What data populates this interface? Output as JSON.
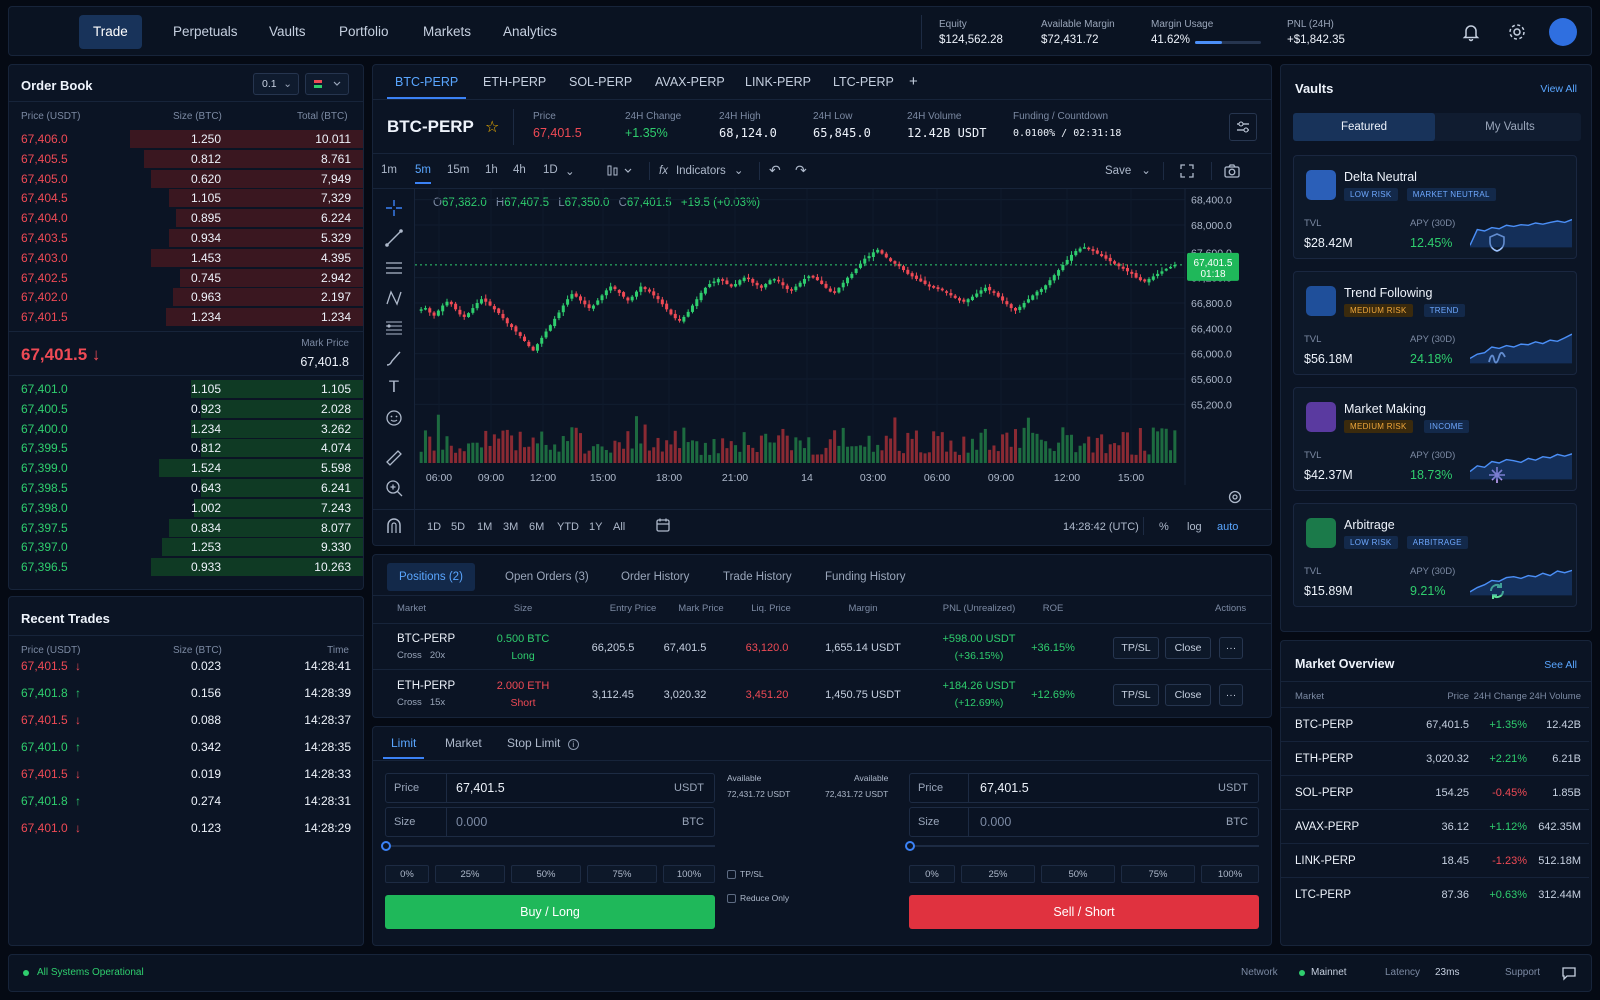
{
  "nav": {
    "tabs": [
      "Trade",
      "Perpetuals",
      "Vaults",
      "Portfolio",
      "Markets",
      "Analytics"
    ],
    "active": "Trade"
  },
  "account": {
    "equity": {
      "label": "Equity",
      "value": "$124,562.28"
    },
    "available": {
      "label": "Available Margin",
      "value": "$72,431.72"
    },
    "margin_usage": {
      "label": "Margin Usage",
      "value": "41.62%",
      "fraction": 0.4162
    },
    "pnl": {
      "label": "PNL (24H)",
      "value": "+$1,842.35"
    }
  },
  "orderbook": {
    "title": "Order Book",
    "grouping": "0.1",
    "col_price": "Price (USDT)",
    "col_size": "Size (BTC)",
    "col_total": "Total (BTC)",
    "asks": [
      [
        "67,406.0",
        "1.250",
        "10.011"
      ],
      [
        "67,405.5",
        "0.812",
        "8.761"
      ],
      [
        "67,405.0",
        "0.620",
        "7,949"
      ],
      [
        "67,404.5",
        "1.105",
        "7,329"
      ],
      [
        "67,404.0",
        "0.895",
        "6.224"
      ],
      [
        "67,403.5",
        "0.934",
        "5.329"
      ],
      [
        "67,403.0",
        "1.453",
        "4.395"
      ],
      [
        "67,402.5",
        "0.745",
        "2.942"
      ],
      [
        "67,402.0",
        "0.963",
        "2.197"
      ],
      [
        "67,401.5",
        "1.234",
        "1.234"
      ]
    ],
    "ask_depth": [
      0.66,
      0.62,
      0.6,
      0.55,
      0.53,
      0.55,
      0.6,
      0.52,
      0.54,
      0.56
    ],
    "last_price": "67,401.5",
    "mark_label": "Mark Price",
    "mark_price": "67,401.8",
    "bids": [
      [
        "67,401.0",
        "1.105",
        "1.105"
      ],
      [
        "67,400.5",
        "0.923",
        "2.028"
      ],
      [
        "67,400.0",
        "1.234",
        "3.262"
      ],
      [
        "67,399.5",
        "0.812",
        "4.074"
      ],
      [
        "67,399.0",
        "1.524",
        "5.598"
      ],
      [
        "67,398.5",
        "0.643",
        "6.241"
      ],
      [
        "67,398.0",
        "1.002",
        "7.243"
      ],
      [
        "67,397.5",
        "0.834",
        "8.077"
      ],
      [
        "67,397.0",
        "1.253",
        "9.330"
      ],
      [
        "67,396.5",
        "0.933",
        "10.263"
      ]
    ],
    "bid_depth": [
      0.49,
      0.46,
      0.49,
      0.46,
      0.58,
      0.46,
      0.48,
      0.55,
      0.57,
      0.6
    ]
  },
  "recent_trades": {
    "title": "Recent Trades",
    "col_price": "Price (USDT)",
    "col_size": "Size (BTC)",
    "col_time": "Time",
    "rows": [
      [
        "67,401.5",
        "0.023",
        "14:28:41",
        "down"
      ],
      [
        "67,401.8",
        "0.156",
        "14:28:39",
        "up"
      ],
      [
        "67,401.5",
        "0.088",
        "14:28:37",
        "down"
      ],
      [
        "67,401.0",
        "0.342",
        "14:28:35",
        "up"
      ],
      [
        "67,401.5",
        "0.019",
        "14:28:33",
        "down"
      ],
      [
        "67,401.8",
        "0.274",
        "14:28:31",
        "up"
      ],
      [
        "67,401.0",
        "0.123",
        "14:28:29",
        "down"
      ]
    ]
  },
  "markets": {
    "tabs": [
      "BTC-PERP",
      "ETH-PERP",
      "SOL-PERP",
      "AVAX-PERP",
      "LINK-PERP",
      "LTC-PERP"
    ],
    "add": "+"
  },
  "ticker": {
    "symbol": "BTC-PERP",
    "price": {
      "label": "Price",
      "value": "67,401.5"
    },
    "change": {
      "label": "24H Change",
      "value": "+1.35%"
    },
    "high": {
      "label": "24H High",
      "value": "68,124.0"
    },
    "low": {
      "label": "24H Low",
      "value": "65,845.0"
    },
    "volume": {
      "label": "24H Volume",
      "value": "12.42B USDT"
    },
    "funding": {
      "label": "Funding / Countdown",
      "value": "0.0100% / 02:31:18"
    }
  },
  "chart_toolbar": {
    "timeframes": [
      "1m",
      "5m",
      "15m",
      "1h",
      "4h",
      "1D"
    ],
    "active": "5m",
    "indicators": "Indicators",
    "save": "Save"
  },
  "ohlc": {
    "o": "67,382.0",
    "h": "67,407.5",
    "l": "67,350.0",
    "c": "67,401.5",
    "chg": "+19.5 (+0.03%)"
  },
  "chart_data": {
    "type": "candlestick",
    "y_ticks": [
      "68,400.0",
      "68,000.0",
      "67,600.0",
      "67,200.0",
      "66,800.0",
      "66,400.0",
      "66,000.0",
      "65,600.0",
      "65,200.0"
    ],
    "x_ticks": [
      "06:00",
      "09:00",
      "12:00",
      "15:00",
      "18:00",
      "21:00",
      "14",
      "03:00",
      "06:00",
      "09:00",
      "12:00",
      "15:00"
    ],
    "ylim": [
      65000,
      68600
    ],
    "close_series": [
      66700,
      66720,
      66650,
      66600,
      66680,
      66760,
      66820,
      66780,
      66700,
      66620,
      66580,
      66640,
      66720,
      66800,
      66860,
      66820,
      66760,
      66700,
      66640,
      66560,
      66480,
      66420,
      66350,
      66280,
      66200,
      66120,
      66050,
      66150,
      66250,
      66350,
      66450,
      66550,
      66650,
      66760,
      66860,
      66940,
      66900,
      66840,
      66780,
      66720,
      66760,
      66840,
      66920,
      67000,
      67060,
      67020,
      66960,
      66900,
      66840,
      66900,
      66980,
      67060,
      67020,
      66980,
      66920,
      66860,
      66780,
      66700,
      66620,
      66560,
      66520,
      66580,
      66660,
      66760,
      66860,
      66960,
      67040,
      67100,
      67140,
      67180,
      67150,
      67100,
      67060,
      67100,
      67160,
      67200,
      67180,
      67120,
      67080,
      67040,
      67100,
      67160,
      67180,
      67140,
      67080,
      67020,
      67000,
      67060,
      67120,
      67180,
      67220,
      67200,
      67160,
      67100,
      67040,
      66980,
      66960,
      67040,
      67120,
      67200,
      67260,
      67340,
      67420,
      67500,
      67540,
      67600,
      67640,
      67580,
      67520,
      67460,
      67420,
      67380,
      67320,
      67260,
      67220,
      67180,
      67140,
      67100,
      67060,
      67040,
      67020,
      67000,
      66960,
      66920,
      66880,
      66840,
      66820,
      66860,
      66900,
      66950,
      67000,
      67040,
      67000,
      66960,
      66900,
      66840,
      66780,
      66720,
      66680,
      66740,
      66800,
      66860,
      66920,
      66980,
      67020,
      67080,
      67160,
      67240,
      67320,
      67400,
      67480,
      67560,
      67620,
      67660,
      67680,
      67660,
      67620,
      67580,
      67540,
      67500,
      67460,
      67420,
      67380,
      67340,
      67300,
      67260,
      67200,
      67160,
      67140,
      67180,
      67220,
      67260,
      67300,
      67340,
      67370,
      67401.5
    ],
    "last_label": "67,401.5",
    "countdown": "01:18"
  },
  "chart_bottom": {
    "ranges": [
      "1D",
      "5D",
      "1M",
      "3M",
      "6M",
      "YTD",
      "1Y",
      "All"
    ],
    "time": "14:28:42 (UTC)",
    "pct": "%",
    "log": "log",
    "auto": "auto"
  },
  "positions": {
    "tabs": [
      "Positions (2)",
      "Open Orders (3)",
      "Order History",
      "Trade History",
      "Funding History"
    ],
    "headers": [
      "Market",
      "Size",
      "Entry Price",
      "Mark Price",
      "Liq. Price",
      "Margin",
      "PNL (Unrealized)",
      "ROE",
      "Actions"
    ],
    "rows": [
      {
        "market": "BTC-PERP",
        "mode": "Cross",
        "lev": "20x",
        "size": "0.500 BTC",
        "side": "Long",
        "entry": "66,205.5",
        "mark": "67,401.5",
        "liq": "63,120.0",
        "margin": "1,655.14 USDT",
        "pnl": "+598.00 USDT",
        "pnl_pct": "(+36.15%)",
        "roe": "+36.15%",
        "tpsl": "TP/SL",
        "close": "Close",
        "more": "···"
      },
      {
        "market": "ETH-PERP",
        "mode": "Cross",
        "lev": "15x",
        "size": "2.000 ETH",
        "side": "Short",
        "entry": "3,112.45",
        "mark": "3,020.32",
        "liq": "3,451.20",
        "margin": "1,450.75 USDT",
        "pnl": "+184.26 USDT",
        "pnl_pct": "(+12.69%)",
        "roe": "+12.69%",
        "tpsl": "TP/SL",
        "close": "Close",
        "more": "···"
      }
    ]
  },
  "order_form": {
    "tabs": [
      "Limit",
      "Market",
      "Stop Limit"
    ],
    "price_label": "Price",
    "price": "67,401.5",
    "unit_quote": "USDT",
    "size_label": "Size",
    "size_placeholder": "0.000",
    "unit_base": "BTC",
    "pcts": [
      "0%",
      "25%",
      "50%",
      "75%",
      "100%"
    ],
    "available_label": "Available",
    "available_value": "72,431.72 USDT",
    "tpsl": "TP/SL",
    "reduce_only": "Reduce Only",
    "buy": "Buy / Long",
    "sell": "Sell / Short"
  },
  "vaults": {
    "title": "Vaults",
    "view_all": "View All",
    "tabs": [
      "Featured",
      "My Vaults"
    ],
    "items": [
      {
        "name": "Delta Neutral",
        "tags": [
          "LOW RISK",
          "MARKET NEUTRAL"
        ],
        "tvl_label": "TVL",
        "tvl": "$28.42M",
        "apy_label": "APY (30D)",
        "apy": "12.45%",
        "icon": "shield-icon",
        "color": "#2b5fb8"
      },
      {
        "name": "Trend Following",
        "tags": [
          "MEDIUM RISK",
          "TREND"
        ],
        "tvl_label": "TVL",
        "tvl": "$56.18M",
        "apy_label": "APY (30D)",
        "apy": "24.18%",
        "icon": "wave-icon",
        "color": "#1f4f9a"
      },
      {
        "name": "Market Making",
        "tags": [
          "MEDIUM RISK",
          "INCOME"
        ],
        "tvl_label": "TVL",
        "tvl": "$42.37M",
        "apy_label": "APY (30D)",
        "apy": "18.73%",
        "icon": "sparkle-icon",
        "color": "#5a3aa0"
      },
      {
        "name": "Arbitrage",
        "tags": [
          "LOW RISK",
          "ARBITRAGE"
        ],
        "tvl_label": "TVL",
        "tvl": "$15.89M",
        "apy_label": "APY (30D)",
        "apy": "9.21%",
        "icon": "arrows-cycle-icon",
        "color": "#1b7a4a"
      }
    ]
  },
  "market_overview": {
    "title": "Market Overview",
    "see_all": "See All",
    "headers": [
      "Market",
      "Price",
      "24H Change",
      "24H Volume"
    ],
    "rows": [
      [
        "BTC-PERP",
        "67,401.5",
        "+1.35%",
        "12.42B"
      ],
      [
        "ETH-PERP",
        "3,020.32",
        "+2.21%",
        "6.21B"
      ],
      [
        "SOL-PERP",
        "154.25",
        "-0.45%",
        "1.85B"
      ],
      [
        "AVAX-PERP",
        "36.12",
        "+1.12%",
        "642.35M"
      ],
      [
        "LINK-PERP",
        "18.45",
        "-1.23%",
        "512.18M"
      ],
      [
        "LTC-PERP",
        "87.36",
        "+0.63%",
        "312.44M"
      ]
    ]
  },
  "status": {
    "systems": "All Systems Operational",
    "network_label": "Network",
    "network": "Mainnet",
    "latency_label": "Latency",
    "latency": "23ms",
    "support": "Support"
  },
  "colors": {
    "up": "#2fce6e",
    "down": "#ef4a55",
    "accent": "#3b82f6"
  }
}
